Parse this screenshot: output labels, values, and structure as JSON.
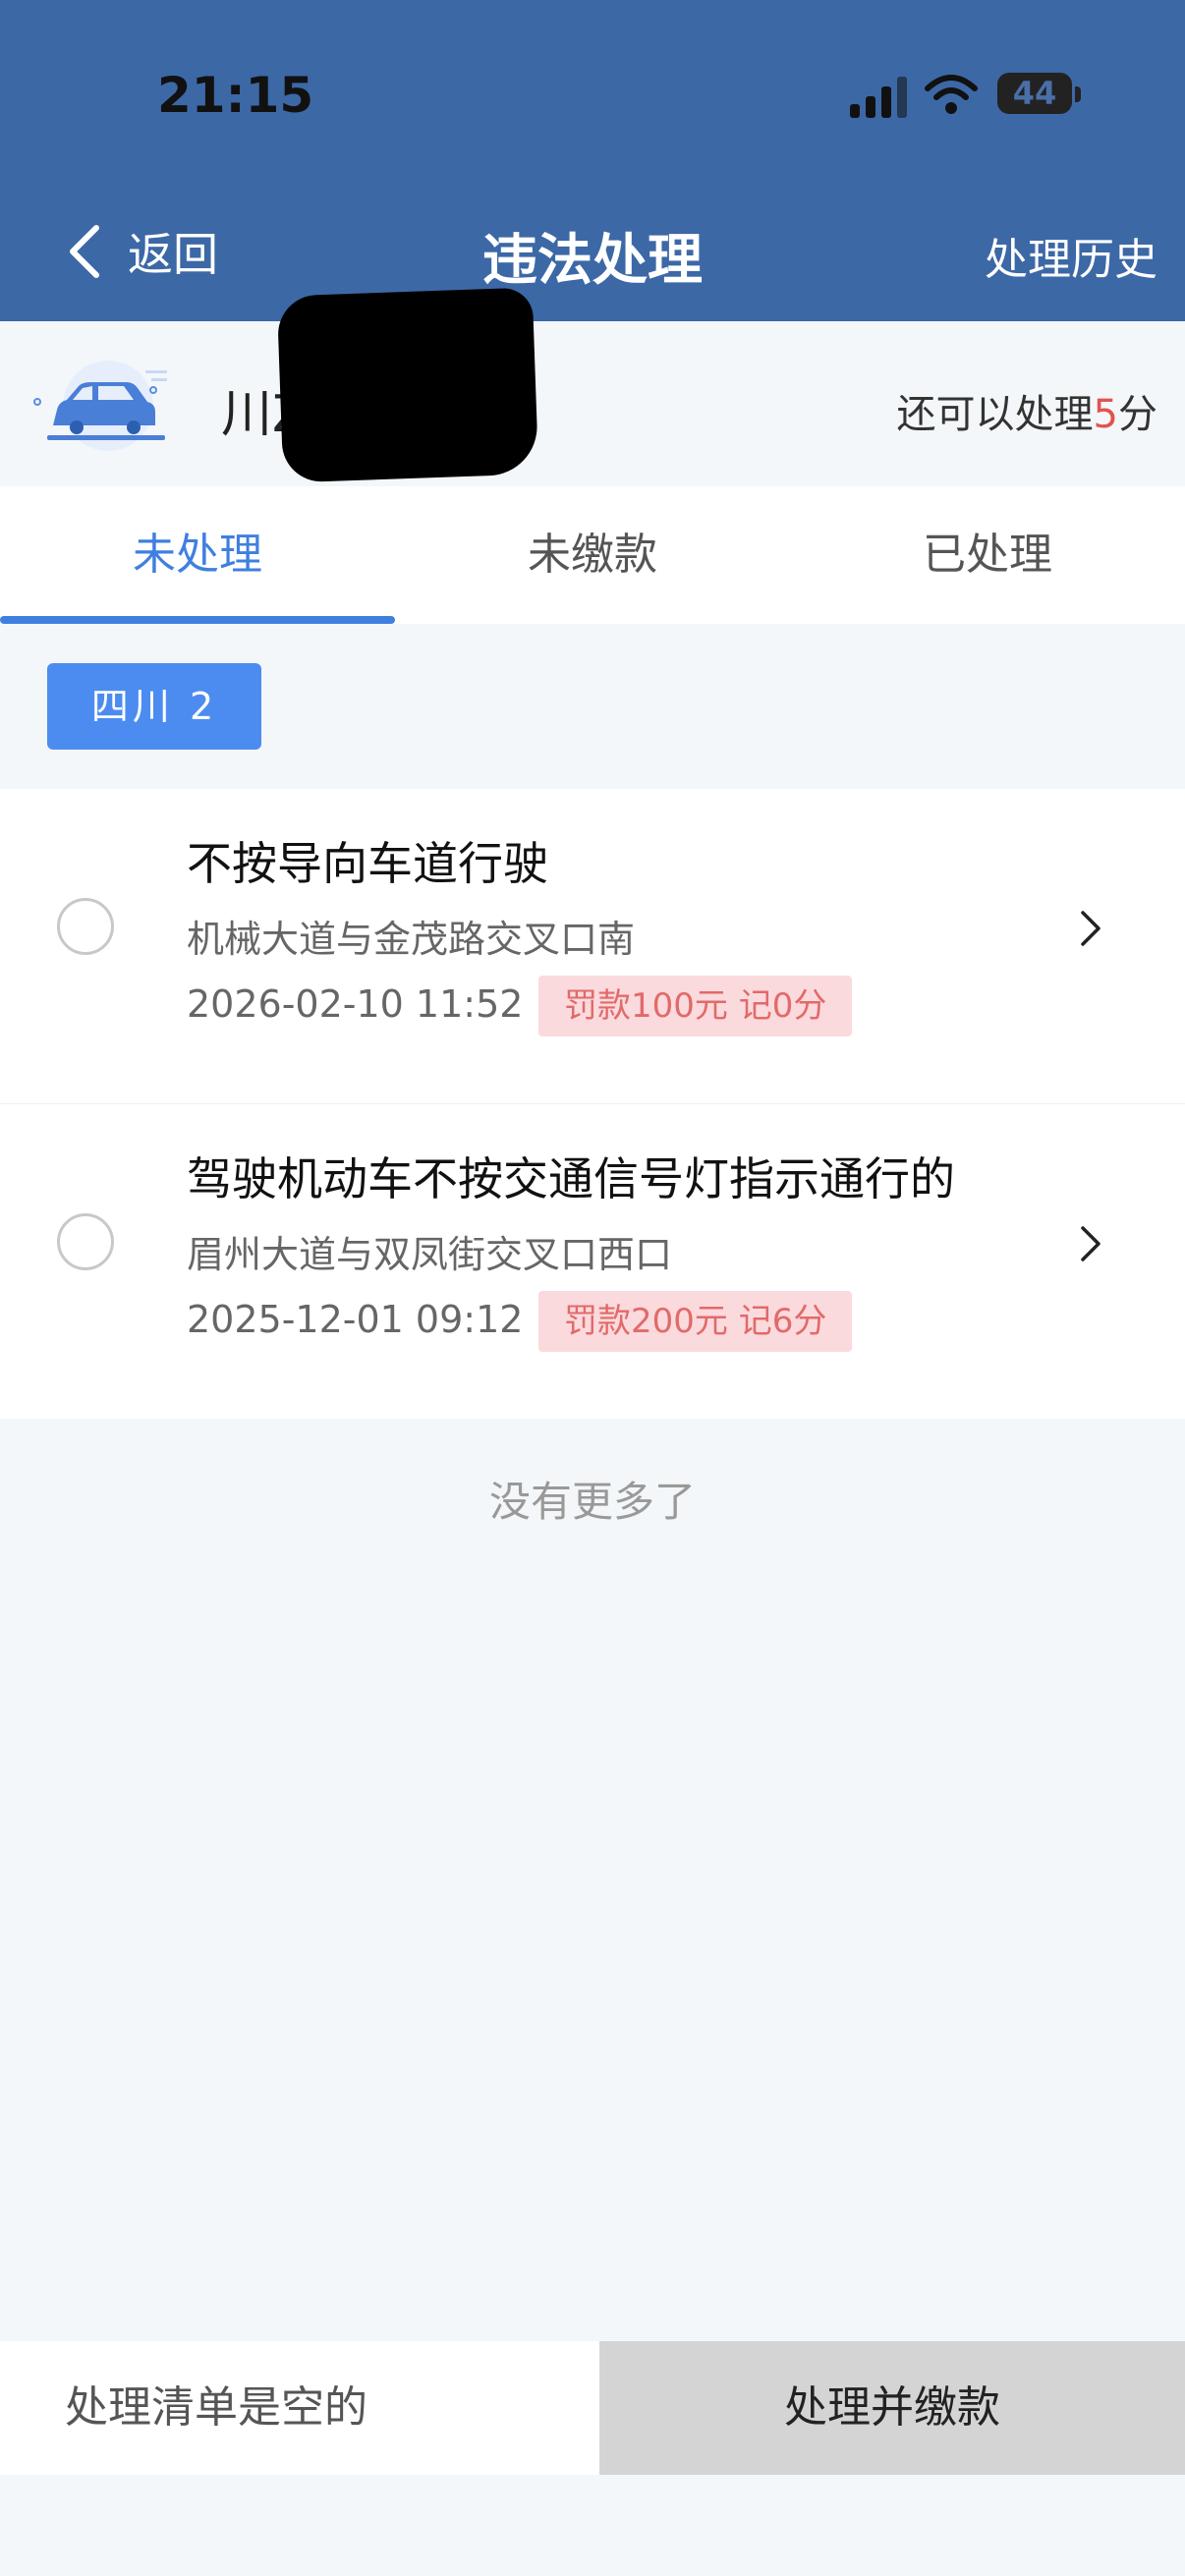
{
  "status": {
    "time": "21:15",
    "battery": "44"
  },
  "nav": {
    "back_label": "返回",
    "title": "违法处理",
    "history_label": "处理历史"
  },
  "vehicle": {
    "plate": "川Z",
    "remaining_prefix": "还可以处理",
    "remaining_count": "5",
    "remaining_suffix": "分"
  },
  "tabs": [
    {
      "label": "未处理",
      "active": true
    },
    {
      "label": "未缴款",
      "active": false
    },
    {
      "label": "已处理",
      "active": false
    }
  ],
  "region_chip": "四川 2",
  "violations": [
    {
      "title": "不按导向车道行驶",
      "location": "机械大道与金茂路交叉口南",
      "time": "2026-02-10 11:52",
      "penalty": "罚款100元 记0分"
    },
    {
      "title": "驾驶机动车不按交通信号灯指示通行的",
      "location": "眉州大道与双凤街交叉口西口",
      "time": "2025-12-01 09:12",
      "penalty": "罚款200元 记6分"
    }
  ],
  "no_more": "没有更多了",
  "bottom": {
    "empty_label": "处理清单是空的",
    "pay_button": "处理并缴款"
  },
  "colors": {
    "header": "#3c68a6",
    "accent": "#3f7fe0",
    "penalty_bg": "#fadadd",
    "penalty_text": "#e26a6a"
  }
}
